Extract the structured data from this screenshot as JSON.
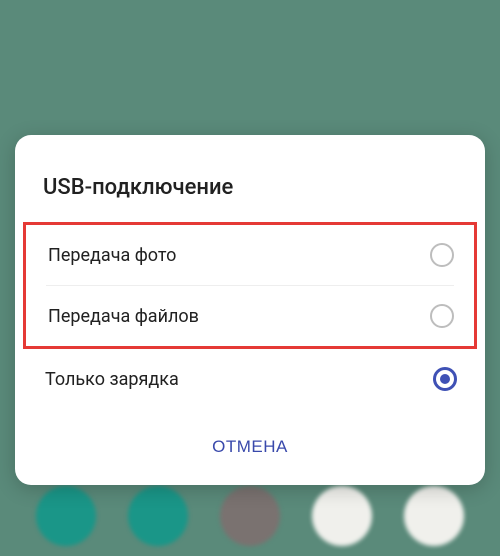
{
  "dialog": {
    "title": "USB-подключение",
    "options": [
      {
        "label": "Передача фото",
        "selected": false
      },
      {
        "label": "Передача файлов",
        "selected": false
      },
      {
        "label": "Только зарядка",
        "selected": true
      }
    ],
    "cancel_label": "ОТМЕНА"
  }
}
